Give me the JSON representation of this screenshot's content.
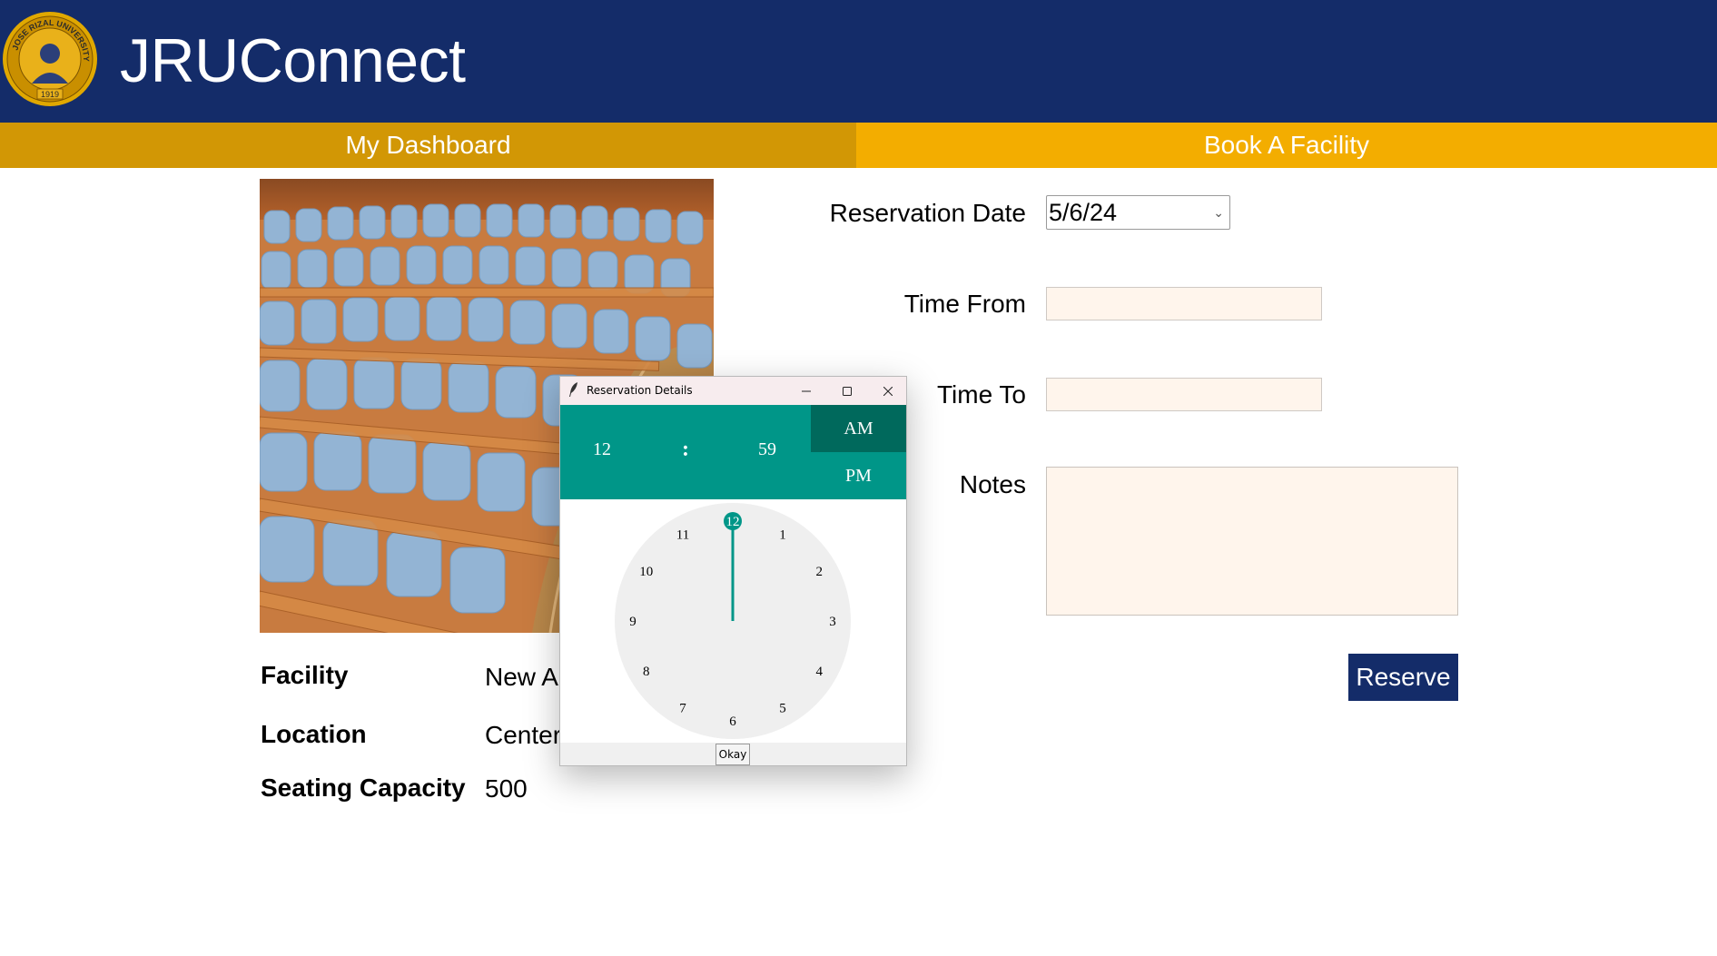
{
  "app": {
    "title": "JRUConnect",
    "logo": {
      "text": "JOSE RIZAL UNIVERSITY",
      "year": "1919"
    }
  },
  "nav": {
    "tabs": [
      {
        "label": "My Dashboard"
      },
      {
        "label": "Book A Facility"
      }
    ]
  },
  "facility": {
    "facility_label": "Facility",
    "facility_value": "New Au",
    "location_label": "Location",
    "location_value": "Center",
    "capacity_label": "Seating Capacity",
    "capacity_value": "500"
  },
  "form": {
    "date_label": "Reservation Date",
    "date_value": "5/6/24",
    "time_from_label": "Time From",
    "time_from_value": "",
    "time_to_label": "Time To",
    "time_to_value": "",
    "notes_label": "Notes",
    "notes_value": "",
    "reserve_label": "Reserve"
  },
  "dialog": {
    "title": "Reservation Details",
    "hour": "12",
    "separator": ":",
    "minute": "59",
    "am_label": "AM",
    "pm_label": "PM",
    "selected_period": "AM",
    "clock_numbers": [
      "12",
      "1",
      "2",
      "3",
      "4",
      "5",
      "6",
      "7",
      "8",
      "9",
      "10",
      "11"
    ],
    "selected_hour": 12,
    "okay_label": "Okay"
  },
  "colors": {
    "header_bg": "#142c69",
    "dashboard_tab": "#d29705",
    "book_tab": "#f3ad00",
    "teal": "#009688",
    "teal_dark": "#00695c",
    "input_bg": "#fff5ec"
  }
}
